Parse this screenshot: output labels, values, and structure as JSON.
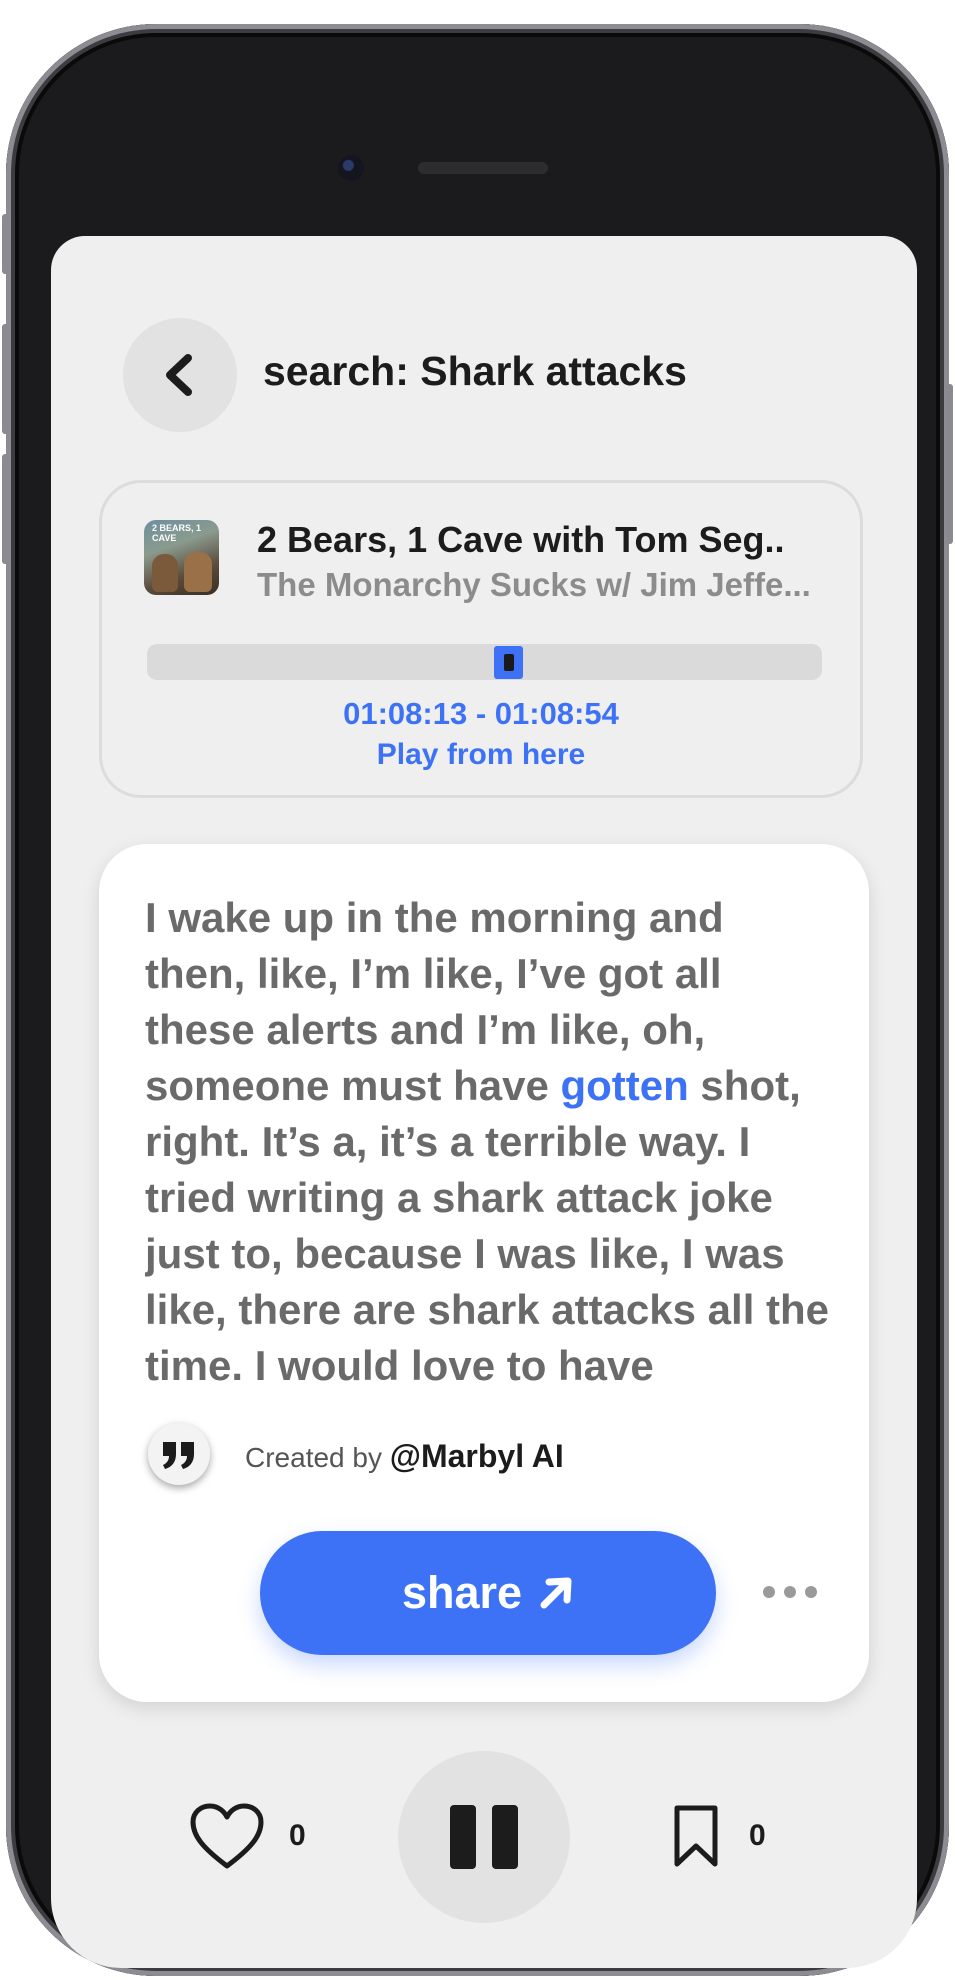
{
  "header": {
    "title": "search: Shark attacks"
  },
  "episode": {
    "title": "2 Bears, 1 Cave with Tom Seg..",
    "subtitle": "The Monarchy Sucks w/ Jim Jeffe...",
    "thumbnail_text": "2 BEARS, 1 CAVE",
    "progress": 0.6,
    "timestamp": "01:08:13 - 01:08:54",
    "play_label": "Play from here"
  },
  "quote": {
    "text_before": "I wake up in the morning and then, like, I’m like, I’ve got all these alerts and I’m like, oh, someone must have ",
    "highlight": "gotten",
    "text_after": " shot, right. It’s a, it’s a terrible way. I tried writing a shark attack joke just to, because I was like, I was like, there are shark attacks all the time. I would love to have",
    "created_by_label": "Created by",
    "handle": "@Marbyl AI",
    "share_label": "share"
  },
  "footer": {
    "like_count": "0",
    "bookmark_count": "0"
  },
  "colors": {
    "accent": "#3d72f6",
    "screen_bg": "#efefef"
  },
  "icons": [
    "back-chevron-icon",
    "quote-icon",
    "arrow-up-right-icon",
    "more-icon",
    "heart-icon",
    "pause-icon",
    "bookmark-icon"
  ]
}
